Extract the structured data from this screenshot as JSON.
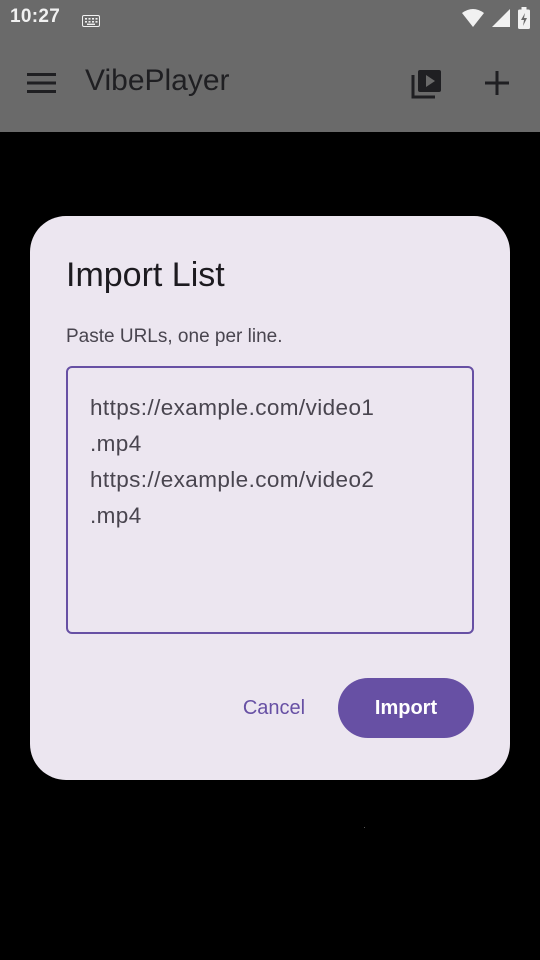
{
  "status_bar": {
    "time": "10:27",
    "icons": [
      "keyboard-icon",
      "wifi-icon",
      "signal-icon",
      "battery-icon"
    ]
  },
  "app_bar": {
    "title": "VibePlayer",
    "icons": [
      "menu-icon",
      "playlist-play-icon",
      "add-icon"
    ]
  },
  "dialog": {
    "title": "Import List",
    "message": "Paste URLs, one per line.",
    "url_text": "https://example.com/video1\n.mp4\nhttps://example.com/video2\n.mp4",
    "cancel_label": "Cancel",
    "import_label": "Import"
  },
  "colors": {
    "accent": "#6750a4",
    "dialog_bg": "#ece6f0",
    "scrim_bar": "#6a6a6a"
  }
}
